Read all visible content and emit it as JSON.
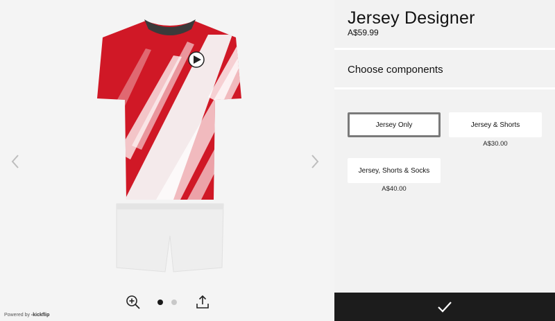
{
  "product": {
    "title": "Jersey Designer",
    "price": "A$59.99"
  },
  "components": {
    "heading": "Choose components",
    "options": [
      {
        "label": "Jersey Only",
        "price": "",
        "selected": true
      },
      {
        "label": "Jersey & Shorts",
        "price": "A$30.00",
        "selected": false
      },
      {
        "label": "Jersey, Shorts & Socks",
        "price": "A$40.00",
        "selected": false
      }
    ]
  },
  "viewer": {
    "pagination": {
      "current": 1,
      "total": 2
    }
  },
  "footer": {
    "powered_prefix": "Powered by",
    "powered_brand": "kickflip"
  },
  "colors": {
    "jersey_red": "#d01826",
    "jersey_white": "#f6f6f6",
    "collar": "#3a3a3a",
    "confirm_bar": "#1c1c1c"
  },
  "icons": [
    "chevron-left-icon",
    "chevron-right-icon",
    "zoom-in-icon",
    "share-icon",
    "checkmark-icon"
  ]
}
